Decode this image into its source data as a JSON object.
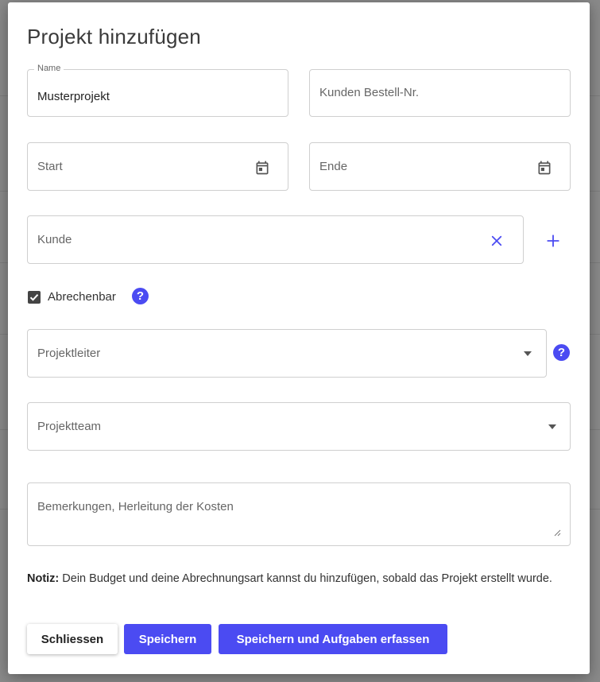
{
  "dialog": {
    "title": "Projekt hinzufügen",
    "name_label": "Name",
    "name_value": "Musterprojekt",
    "customer_order_placeholder": "Kunden Bestell-Nr.",
    "start_placeholder": "Start",
    "end_placeholder": "Ende",
    "customer_placeholder": "Kunde",
    "billable_label": "Abrechenbar",
    "billable_checked": true,
    "project_lead_placeholder": "Projektleiter",
    "project_team_placeholder": "Projektteam",
    "remarks_placeholder": "Bemerkungen, Herleitung der Kosten",
    "note_label": "Notiz:",
    "note_text": " Dein Budget und deine Abrechnungsart kannst du hinzufügen, sobald das Projekt erstellt wurde.",
    "buttons": {
      "close": "Schliessen",
      "save": "Speichern",
      "save_and_tasks": "Speichern und Aufgaben erfassen"
    },
    "icons": {
      "calendar": "calendar-icon",
      "clear": "close-icon",
      "add": "plus-icon",
      "help": "help-icon",
      "dropdown": "caret-down-icon"
    },
    "colors": {
      "accent": "#4b4bf2",
      "text": "#3a3a3a",
      "border": "#cfcfcf",
      "overlay": "#8a8a8a"
    }
  }
}
